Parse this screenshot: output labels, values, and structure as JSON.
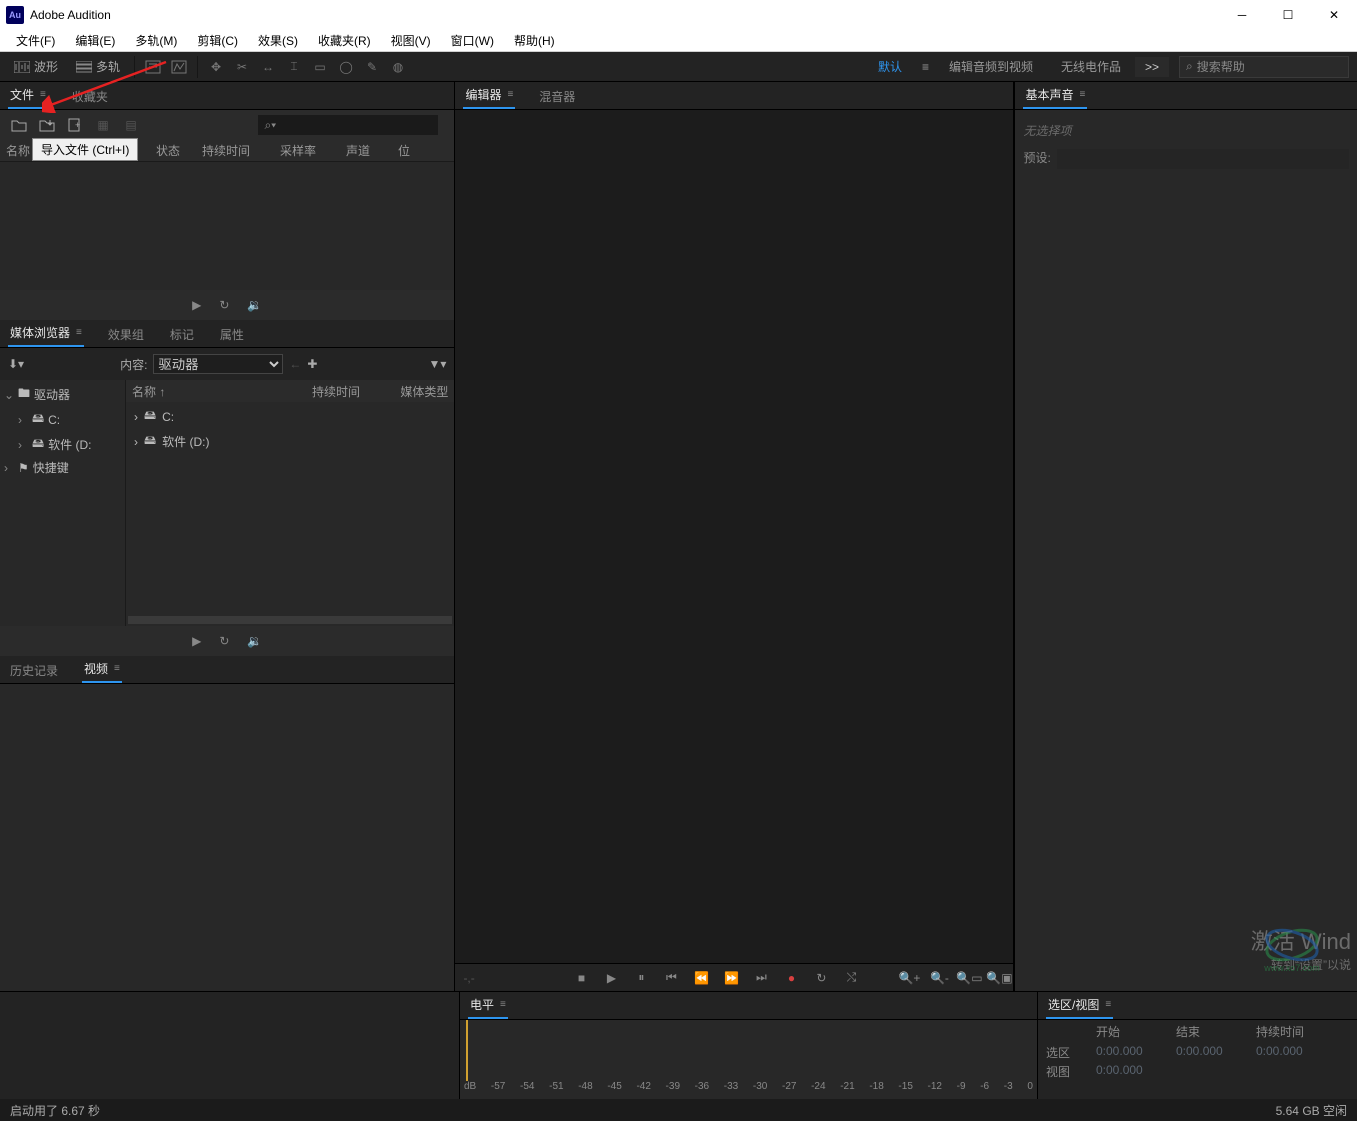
{
  "titlebar": {
    "app_name": "Adobe Audition"
  },
  "menubar": {
    "items": [
      "文件(F)",
      "编辑(E)",
      "多轨(M)",
      "剪辑(C)",
      "效果(S)",
      "收藏夹(R)",
      "视图(V)",
      "窗口(W)",
      "帮助(H)"
    ]
  },
  "topbar": {
    "waveform": "波形",
    "multitrack": "多轨",
    "workspaces": {
      "default": "默认",
      "edit_to_video": "编辑音频到视频",
      "radio": "无线电作品"
    },
    "more": ">>",
    "search_placeholder": "搜索帮助"
  },
  "files_panel": {
    "tab_files": "文件",
    "tab_favorites": "收藏夹",
    "tooltip": "导入文件 (Ctrl+I)",
    "cols": {
      "name": "名称 ↑",
      "status": "状态",
      "duration": "持续时间",
      "sample_rate": "采样率",
      "channels": "声道",
      "bit": "位"
    }
  },
  "media_panel": {
    "tabs": {
      "browser": "媒体浏览器",
      "effects_rack": "效果组",
      "markers": "标记",
      "properties": "属性"
    },
    "content_label": "内容:",
    "content_value": "驱动器",
    "tree": {
      "driver": "驱动器",
      "c": "C:",
      "software_d": "软件 (D:",
      "shortcuts": "快捷键"
    },
    "list_cols": {
      "name": "名称 ↑",
      "duration": "持续时间",
      "media_type": "媒体类型"
    },
    "rows": {
      "c": "C:",
      "d": "软件 (D:)"
    }
  },
  "history_panel": {
    "tab_history": "历史记录",
    "tab_video": "视频"
  },
  "editor_panel": {
    "tab_editor": "编辑器",
    "tab_mixer": "混音器"
  },
  "right_panel": {
    "title": "基本声音",
    "no_selection": "无选择项",
    "preset_label": "预设:"
  },
  "levels_panel": {
    "title": "电平",
    "db_label": "dB",
    "ticks": [
      "-57",
      "-54",
      "-51",
      "-48",
      "-45",
      "-42",
      "-39",
      "-36",
      "-33",
      "-30",
      "-27",
      "-24",
      "-21",
      "-18",
      "-15",
      "-12",
      "-9",
      "-6",
      "-3",
      "0"
    ]
  },
  "selview_panel": {
    "title": "选区/视图",
    "cols": {
      "start": "开始",
      "end": "结束",
      "duration": "持续时间"
    },
    "rows": {
      "selection": {
        "label": "选区",
        "start": "0:00.000",
        "end": "0:00.000",
        "duration": "0:00.000"
      },
      "view": {
        "label": "视图",
        "start": "0:00.000"
      }
    }
  },
  "watermark": {
    "line1": "激活 Wind",
    "line2": "转到“设置”以说",
    "url": "www.xo7.com"
  },
  "statusbar": {
    "left": "启动用了 6.67 秒",
    "right": "5.64 GB 空闲"
  }
}
